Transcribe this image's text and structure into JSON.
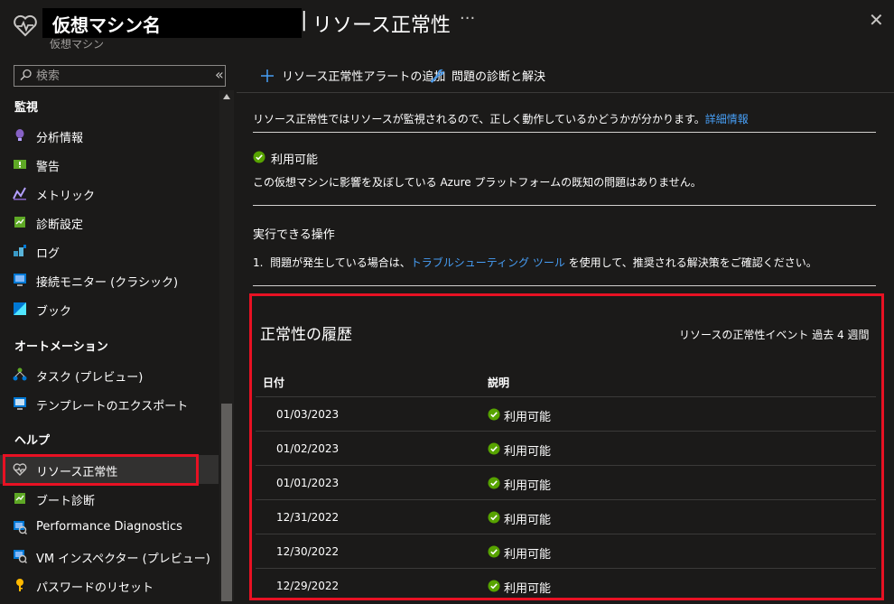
{
  "header": {
    "vm_name": "仮想マシン名",
    "title_separator": "|",
    "page_title": "リソース正常性",
    "subtitle": "仮想マシン",
    "more_label": "···",
    "close_label": "✕"
  },
  "sidebar": {
    "search_placeholder": "検索",
    "collapse_label": "«",
    "sections": [
      {
        "title": "監視",
        "items": [
          {
            "label": "分析情報",
            "icon": "bulb-icon"
          },
          {
            "label": "警告",
            "icon": "alert-icon"
          },
          {
            "label": "メトリック",
            "icon": "metrics-icon"
          },
          {
            "label": "診断設定",
            "icon": "diagnostic-settings-icon"
          },
          {
            "label": "ログ",
            "icon": "logs-icon"
          },
          {
            "label": "接続モニター (クラシック)",
            "icon": "connection-monitor-icon"
          },
          {
            "label": "ブック",
            "icon": "workbook-icon"
          }
        ]
      },
      {
        "title": "オートメーション",
        "items": [
          {
            "label": "タスク (プレビュー)",
            "icon": "tasks-icon"
          },
          {
            "label": "テンプレートのエクスポート",
            "icon": "export-template-icon"
          }
        ]
      },
      {
        "title": "ヘルプ",
        "items": [
          {
            "label": "リソース正常性",
            "icon": "heart-monitor-icon",
            "selected": true
          },
          {
            "label": "ブート診断",
            "icon": "boot-diagnostics-icon"
          },
          {
            "label": "Performance Diagnostics",
            "icon": "performance-diagnostics-icon"
          },
          {
            "label": "VM インスペクター (プレビュー)",
            "icon": "vm-inspector-icon"
          },
          {
            "label": "パスワードのリセット",
            "icon": "key-icon"
          }
        ]
      }
    ]
  },
  "toolbar": {
    "add_alert_label": "リソース正常性アラートの追加",
    "diagnose_label": "問題の診断と解決"
  },
  "main": {
    "intro_text": "リソース正常性ではリソースが監視されるので、正しく動作しているかどうかが分かります。",
    "learn_more_label": "詳細情報",
    "status_label": "利用可能",
    "status_description": "この仮想マシンに影響を及ぼしている Azure プラットフォームの既知の問題はありません。",
    "actions_title": "実行できる操作",
    "action_prefix": "1.  問題が発生している場合は、",
    "action_link": "トラブルシューティング ツール",
    "action_suffix": " を使用して、推奨される解決策をご確認ください。"
  },
  "history": {
    "title": "正常性の履歴",
    "subtitle": "リソースの正常性イベント 過去 4 週間",
    "col_date": "日付",
    "col_description": "説明",
    "rows": [
      {
        "date": "01/03/2023",
        "status": "利用可能"
      },
      {
        "date": "01/02/2023",
        "status": "利用可能"
      },
      {
        "date": "01/01/2023",
        "status": "利用可能"
      },
      {
        "date": "12/31/2022",
        "status": "利用可能"
      },
      {
        "date": "12/30/2022",
        "status": "利用可能"
      },
      {
        "date": "12/29/2022",
        "status": "利用可能"
      }
    ]
  },
  "colors": {
    "accent_link": "#479ef5",
    "highlight_red": "#e81123",
    "status_green": "#57a300"
  }
}
